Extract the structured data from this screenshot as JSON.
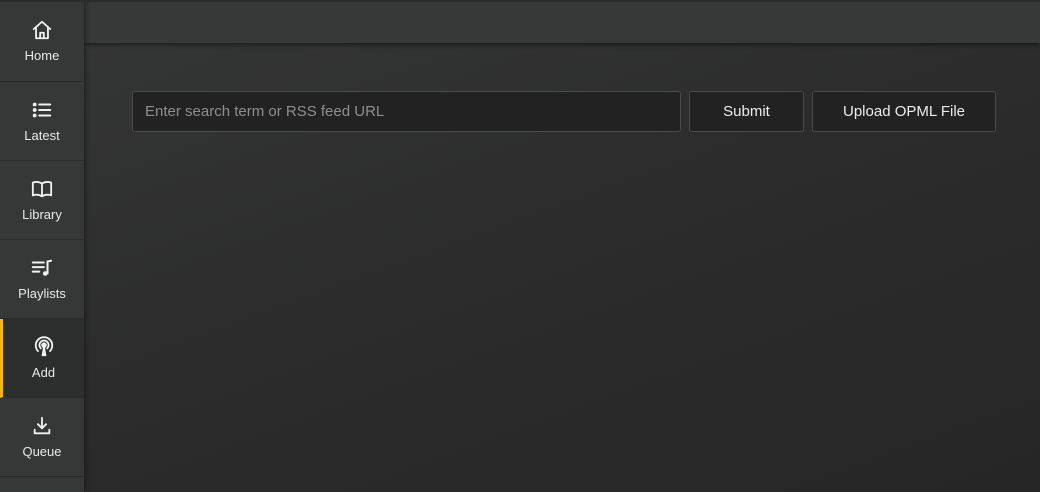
{
  "sidebar": {
    "items": [
      {
        "label": "Home",
        "icon": "home-icon",
        "active": false
      },
      {
        "label": "Latest",
        "icon": "list-icon",
        "active": false
      },
      {
        "label": "Library",
        "icon": "book-icon",
        "active": false
      },
      {
        "label": "Playlists",
        "icon": "playlist-icon",
        "active": false
      },
      {
        "label": "Add",
        "icon": "podcast-icon",
        "active": true
      },
      {
        "label": "Queue",
        "icon": "download-icon",
        "active": false
      }
    ]
  },
  "main": {
    "search": {
      "value": "",
      "placeholder": "Enter search term or RSS feed URL"
    },
    "submit_label": "Submit",
    "upload_label": "Upload OPML File"
  },
  "colors": {
    "accent": "#f5b80f",
    "sidebar_bg": "#363838",
    "main_bg": "#2b2c2c",
    "input_bg": "#222222"
  }
}
